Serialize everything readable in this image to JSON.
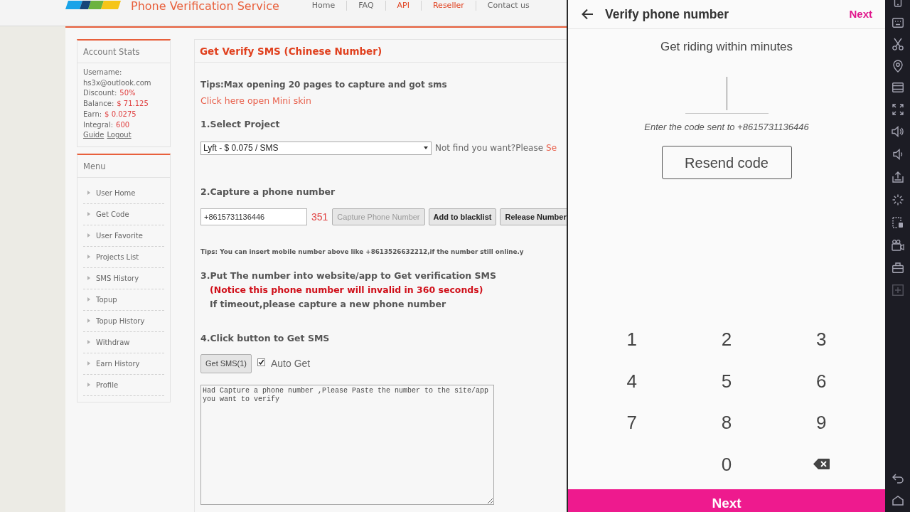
{
  "site_header": {
    "title": "Phone Verification Service",
    "nav": [
      {
        "label": "Home",
        "color": "#666666"
      },
      {
        "label": "FAQ",
        "color": "#666666"
      },
      {
        "label": "API",
        "color": "#e0401e"
      },
      {
        "label": "Reseller",
        "color": "#e0401e"
      },
      {
        "label": "Contact us",
        "color": "#666666"
      }
    ]
  },
  "account_stats": {
    "title": "Account Stats",
    "fields": [
      {
        "kind": "stacked",
        "label": "Username:",
        "value": "hs3x@outlook.com"
      },
      {
        "kind": "inline",
        "label": "Discount:",
        "value": "50%"
      },
      {
        "kind": "inline",
        "label": "Balance:",
        "value": "$ 71.125"
      },
      {
        "kind": "inline",
        "label": "Earn:",
        "value": "$ 0.0275"
      },
      {
        "kind": "inline",
        "label": "Integral:",
        "value": "600"
      }
    ],
    "links": [
      "Guide",
      "Logout"
    ]
  },
  "menu": {
    "title": "Menu",
    "items": [
      "User Home",
      "Get Code",
      "User Favorite",
      "Projects List",
      "SMS History",
      "Topup",
      "Topup History",
      "Withdraw",
      "Earn History",
      "Profile"
    ]
  },
  "verify_panel": {
    "title": "Get Verify SMS (Chinese Number)",
    "tips": "Tips:Max opening 20 pages to capture and got sms",
    "mini_skin_link": "Click here open Mini skin",
    "step1": {
      "heading": "1.Select Project",
      "project": "Lyft - $ 0.075 / SMS",
      "hint": "Not find you want?Please",
      "hint_link": "Se"
    },
    "step2": {
      "heading": "2.Capture a phone number",
      "phone_number": "+8615731136446",
      "countdown": "351",
      "buttons": [
        {
          "label": "Capture Phone Number",
          "disabled": true
        },
        {
          "label": "Add to blacklist",
          "disabled": false
        },
        {
          "label": "Release Number",
          "disabled": false
        }
      ],
      "tips": "Tips: You can insert mobile number above like +8613526632212,if the number still online.y"
    },
    "step3": {
      "heading": "3.Put The number into website/app to Get verification SMS",
      "notice": "(Notice this phone number will invalid in 360 seconds)",
      "note": "If timeout,please capture a new phone number"
    },
    "step4": {
      "heading": "4.Click button to Get SMS",
      "button": "Get SMS(1)",
      "auto_get": {
        "label": "Auto Get",
        "checked": true
      },
      "log": "Had Capture a phone number ,Please Paste the number to the site/app you want to verify"
    }
  },
  "phone_app": {
    "title": "Verify phone number",
    "action": "Next",
    "headline": "Get riding within minutes",
    "code_prompt": "Enter the code sent to +8615731136446",
    "resend_button": "Resend code",
    "keypad": [
      {
        "kind": "digit",
        "label": "1"
      },
      {
        "kind": "digit",
        "label": "2"
      },
      {
        "kind": "digit",
        "label": "3"
      },
      {
        "kind": "digit",
        "label": "4"
      },
      {
        "kind": "digit",
        "label": "5"
      },
      {
        "kind": "digit",
        "label": "6"
      },
      {
        "kind": "digit",
        "label": "7"
      },
      {
        "kind": "digit",
        "label": "8"
      },
      {
        "kind": "digit",
        "label": "9"
      },
      {
        "kind": "digit",
        "label": "0"
      },
      {
        "kind": "backspace"
      }
    ],
    "submit_button": "Next"
  }
}
